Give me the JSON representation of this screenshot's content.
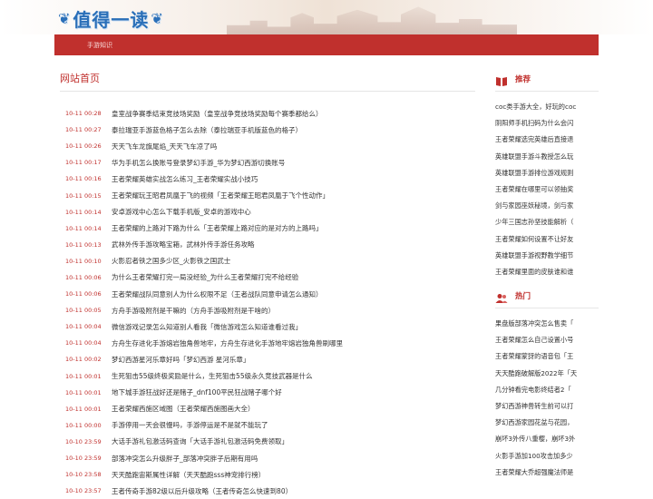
{
  "site": {
    "logo_text": "值得一读"
  },
  "nav": {
    "items": [
      {
        "label": "手游知识"
      }
    ]
  },
  "main": {
    "title": "网站首页",
    "articles": [
      {
        "date": "10-11 00:28",
        "title": "皇室战争赛季结束竞技场奖励（皇室战争竞技场奖励每个赛季都给么）"
      },
      {
        "date": "10-11 00:27",
        "title": "泰拉瑞亚手游蓝色格子怎么去除（泰拉瑞亚手机版蓝色的格子）"
      },
      {
        "date": "10-11 00:26",
        "title": "天天飞车龙旗尾焰_天天飞车凉了吗"
      },
      {
        "date": "10-11 00:17",
        "title": "华为手机怎么换账号登录梦幻手游_华为梦幻西游切换账号"
      },
      {
        "date": "10-11 00:16",
        "title": "王者荣耀英雄实战怎么练习_王者荣耀实战小技巧"
      },
      {
        "date": "10-11 00:15",
        "title": "王者荣耀玩王昭君凤凰于飞的视频「王者荣耀王昭君凤凰于飞个性动作」"
      },
      {
        "date": "10-11 00:14",
        "title": "安卓游戏中心怎么下载手机版_安卓的游戏中心"
      },
      {
        "date": "10-11 00:14",
        "title": "王者荣耀的上路对下路为什么「王者荣耀上路对应的是对方的上路吗」"
      },
      {
        "date": "10-11 00:13",
        "title": "武林外传手游攻略宝箱，武林外传手游任务攻略"
      },
      {
        "date": "10-11 00:10",
        "title": "火影忍者铁之国多少区_火影铁之国武士"
      },
      {
        "date": "10-11 00:06",
        "title": "为什么王者荣耀打完一局没经验_为什么王者荣耀打完不给经验"
      },
      {
        "date": "10-11 00:06",
        "title": "王者荣耀战队同意别人为什么权限不足（王者战队同意申请怎么通知）"
      },
      {
        "date": "10-11 00:05",
        "title": "方舟手游吸附剂是干嘛的（方舟手游吸附剂是干啥的）"
      },
      {
        "date": "10-11 00:04",
        "title": "微信游戏记录怎么知道别人看我「微信游戏怎么知道谁看过我」"
      },
      {
        "date": "10-11 00:04",
        "title": "方舟生存进化手游熔岩独角兽地牢，方舟生存进化手游地牢熔岩独角兽刷哪里"
      },
      {
        "date": "10-11 00:02",
        "title": "梦幻西游星河乐章好吗「梦幻西游 星河乐章」"
      },
      {
        "date": "10-11 00:01",
        "title": "生死狙击55级终极奖励是什么，生死狙击55级永久竞技武器是什么"
      },
      {
        "date": "10-11 00:01",
        "title": "地下城手游狂战好还是赌子_dnf100平民狂战赌子哪个好"
      },
      {
        "date": "10-11 00:01",
        "title": "王者荣耀西施区域图（王者荣耀西施图画大全）"
      },
      {
        "date": "10-11 00:00",
        "title": "手游停用一天会很慢吗，手游停运是不是就不能玩了"
      },
      {
        "date": "10-10 23:59",
        "title": "大话手游礼包激活码查询「大话手游礼包激活码免费领取」"
      },
      {
        "date": "10-10 23:59",
        "title": "部落冲突怎么升级胖子_部落冲突胖子后期有用吗"
      },
      {
        "date": "10-10 23:58",
        "title": "天天酷跑宙斯属性详解（天天酷跑sss神宠排行榜）"
      },
      {
        "date": "10-10 23:57",
        "title": "王者传奇手游82级以后升级攻略（王者传奇怎么快速到80）"
      }
    ]
  },
  "sidebar": {
    "recommend": {
      "title": "推荐",
      "items": [
        "coc类手游大全，好玩的coc",
        "阴阳师手机扫码为什么会闪",
        "王者荣耀选完英雄后直接退",
        "英雄联盟手游斗教授怎么玩",
        "英雄联盟手游排位游戏规则",
        "王者荣耀在哪里可以领抽奖",
        "剑与家园巫妖秘境，剑与家",
        "少年三国志孙坚技能解析（",
        "王者荣耀如何设置不让好友",
        "英雄联盟手游视野教学细节",
        "王者荣耀里面的皮肤谁和谁"
      ]
    },
    "hot": {
      "title": "热门",
      "items": [
        "果盘版部落冲突怎么售卖「",
        "王者荣耀怎么自己设置小号",
        "王者荣耀蒙犽的语音包「王",
        "天天酷跑破解版2022年「天",
        "几分钟看完电影终结者2「",
        "梦幻西游神兽转生前可以打",
        "梦幻西游家园花盆与花园，",
        "崩坏3外传八重樱，崩坏3外",
        "火影手游加100攻击加多少",
        "王者荣耀大乔超强魔法师是"
      ]
    }
  },
  "colors": {
    "brand_red": "#c0302d",
    "logo_blue": "#2a6fb8"
  }
}
